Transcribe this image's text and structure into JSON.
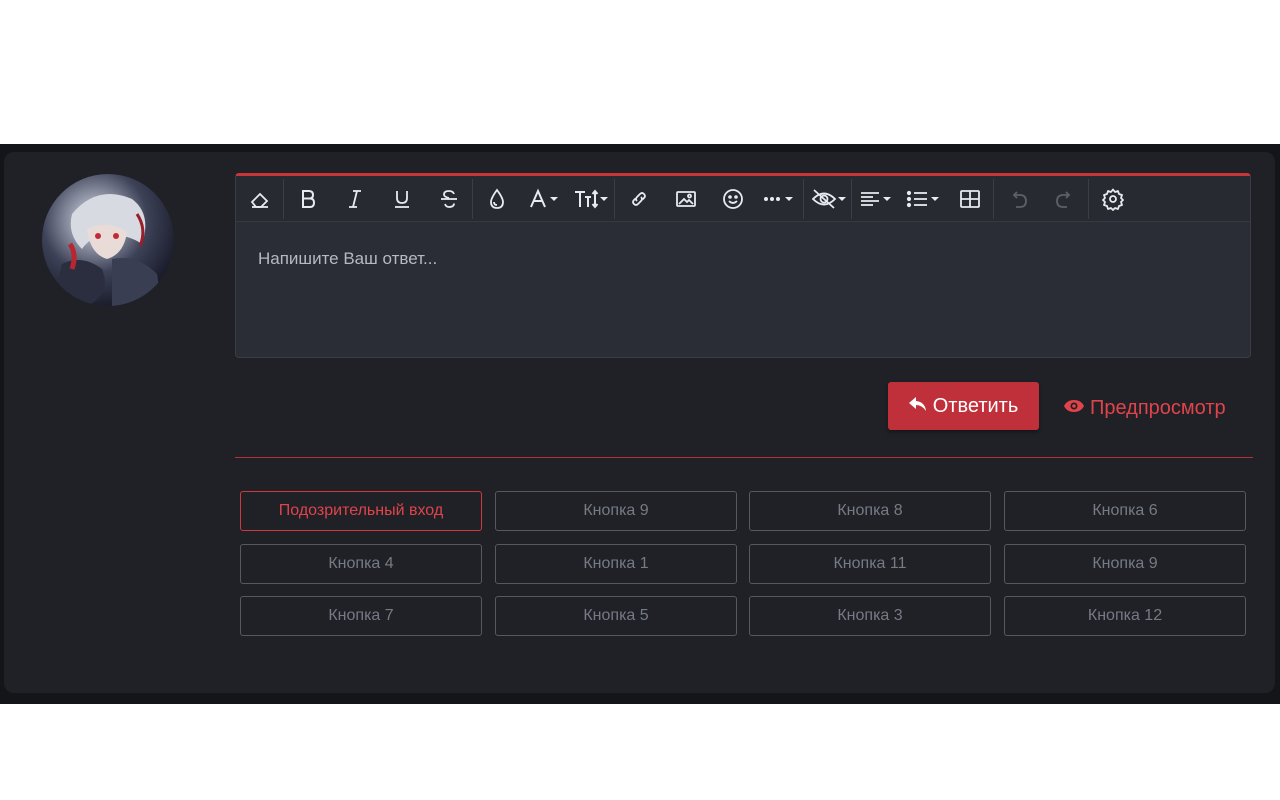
{
  "editor": {
    "placeholder": "Напишите Ваш ответ...",
    "toolbar": [
      {
        "name": "remove-format-icon",
        "enabled": true
      },
      {
        "name": "bold-icon",
        "enabled": true
      },
      {
        "name": "italic-icon",
        "enabled": true
      },
      {
        "name": "underline-icon",
        "enabled": true
      },
      {
        "name": "strikethrough-icon",
        "enabled": true
      },
      {
        "name": "text-color-icon",
        "enabled": true
      },
      {
        "name": "font-family-icon",
        "enabled": true
      },
      {
        "name": "font-size-icon",
        "enabled": true
      },
      {
        "name": "insert-link-icon",
        "enabled": true
      },
      {
        "name": "insert-image-icon",
        "enabled": true
      },
      {
        "name": "smilie-icon",
        "enabled": true
      },
      {
        "name": "more-options-icon",
        "enabled": true
      },
      {
        "name": "hide-content-icon",
        "enabled": true
      },
      {
        "name": "align-icon",
        "enabled": true
      },
      {
        "name": "list-icon",
        "enabled": true
      },
      {
        "name": "insert-table-icon",
        "enabled": true
      },
      {
        "name": "undo-icon",
        "enabled": false
      },
      {
        "name": "redo-icon",
        "enabled": false
      },
      {
        "name": "settings-icon",
        "enabled": true
      }
    ]
  },
  "actions": {
    "reply_label": "Ответить",
    "reply_icon": "reply-icon",
    "preview_label": "Предпросмотр",
    "preview_icon": "eye-icon"
  },
  "colors": {
    "accent": "#c0303a",
    "panel": "#1f2127",
    "editor": "#2a2d35"
  },
  "quick_buttons": [
    {
      "label": "Подозрительный вход",
      "active": true
    },
    {
      "label": "Кнопка 4",
      "active": false
    },
    {
      "label": "Кнопка 7",
      "active": false
    },
    {
      "label": "Кнопка 9",
      "active": false
    },
    {
      "label": "Кнопка 1",
      "active": false
    },
    {
      "label": "Кнопка 5",
      "active": false
    },
    {
      "label": "Кнопка 8",
      "active": false
    },
    {
      "label": "Кнопка 11",
      "active": false
    },
    {
      "label": "Кнопка 3",
      "active": false
    },
    {
      "label": "Кнопка 6",
      "active": false
    },
    {
      "label": "Кнопка 9",
      "active": false
    },
    {
      "label": "Кнопка 12",
      "active": false
    }
  ]
}
